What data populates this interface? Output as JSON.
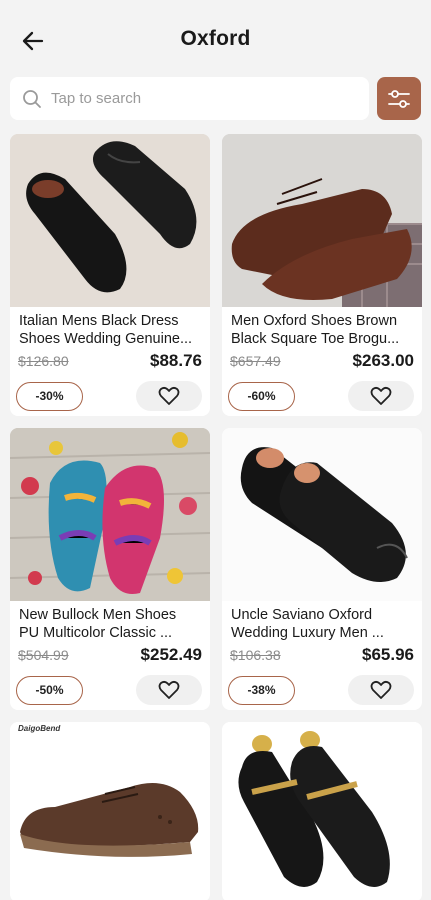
{
  "header": {
    "title": "Oxford",
    "back_icon": "arrow-left-icon"
  },
  "search": {
    "placeholder": "Tap to search",
    "icon": "search-icon",
    "filter_icon": "sliders-icon"
  },
  "colors": {
    "accent": "#a8654a",
    "background": "#f3f3f3",
    "card": "#ffffff"
  },
  "products": [
    {
      "name_line1": "Italian Mens Black Dress",
      "name_line2": "Shoes Wedding Genuine...",
      "old_price": "$126.80",
      "price": "$88.76",
      "discount": "-30%"
    },
    {
      "name_line1": "Men Oxford Shoes Brown",
      "name_line2": "Black Square Toe Brogu...",
      "old_price": "$657.49",
      "price": "$263.00",
      "discount": "-60%"
    },
    {
      "name_line1": "New Bullock Men Shoes",
      "name_line2": "PU Multicolor Classic ...",
      "old_price": "$504.99",
      "price": "$252.49",
      "discount": "-50%"
    },
    {
      "name_line1": "Uncle Saviano Oxford",
      "name_line2": "Wedding Luxury Men ...",
      "old_price": "$106.38",
      "price": "$65.96",
      "discount": "-38%"
    },
    {
      "brand_tag": "DaigoBend"
    },
    {}
  ]
}
